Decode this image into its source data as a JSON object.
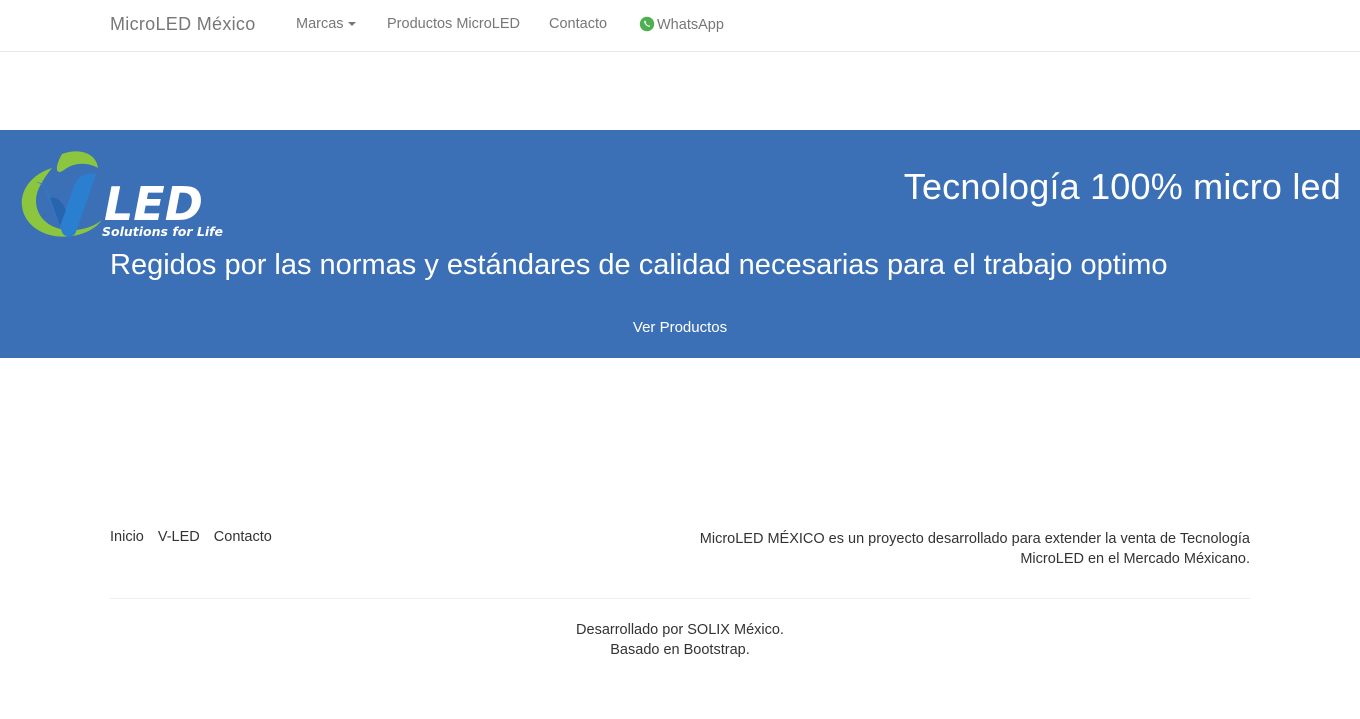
{
  "navbar": {
    "brand": "MicroLED México",
    "items": [
      {
        "label": "Marcas"
      },
      {
        "label": "Productos MicroLED"
      },
      {
        "label": "Contacto"
      },
      {
        "label": "WhatsApp"
      }
    ]
  },
  "hero": {
    "logo": {
      "main": "LED",
      "tagline": "Solutions for Life"
    },
    "title": "Tecnología 100% micro led",
    "subtitle": "Regidos por las normas y estándares de calidad necesarias para el trabajo optimo",
    "button_label": "Ver Productos"
  },
  "footer": {
    "links": [
      "Inicio",
      "V-LED",
      "Contacto"
    ],
    "description_line1": "MicroLED MÉXICO es un proyecto desarrollado para extender la venta de Tecnología",
    "description_line2": "MicroLED en el Mercado Méxicano.",
    "credit_line1": "Desarrollado por SOLIX México.",
    "credit_line2": "Basado en Bootstrap."
  },
  "colors": {
    "hero_bg": "#3b70b7",
    "nav_text": "#777777",
    "whatsapp_green": "#4caf50",
    "logo_green": "#8cc63f"
  },
  "icons": {
    "brands_dropdown": "caret-down-icon",
    "whatsapp": "whatsapp-icon"
  }
}
